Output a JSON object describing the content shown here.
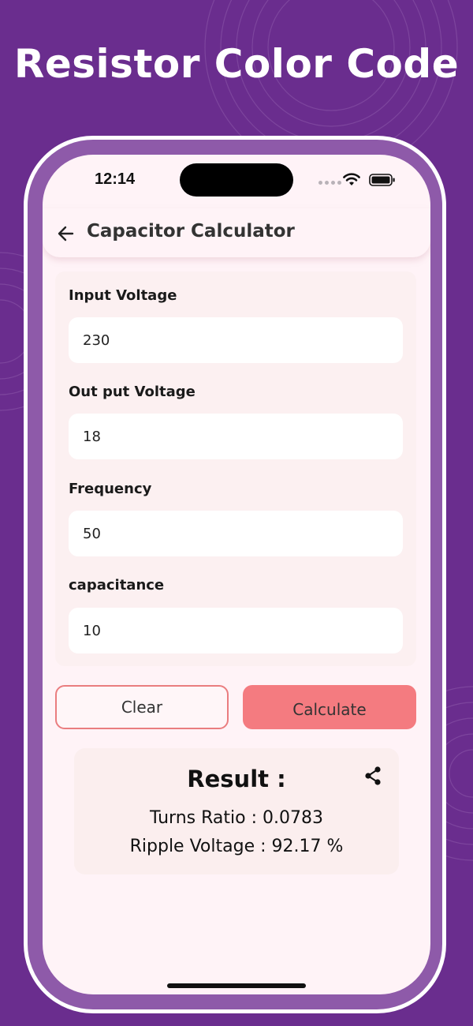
{
  "promo": {
    "title": "Resistor Color Code"
  },
  "status_bar": {
    "time": "12:14"
  },
  "app_bar": {
    "title": "Capacitor Calculator"
  },
  "form": {
    "input_voltage": {
      "label": "Input Voltage",
      "value": "230"
    },
    "output_voltage": {
      "label": "Out put Voltage",
      "value": "18"
    },
    "frequency": {
      "label": "Frequency",
      "value": "50"
    },
    "capacitance": {
      "label": "capacitance",
      "value": "10"
    }
  },
  "buttons": {
    "clear": "Clear",
    "calculate": "Calculate"
  },
  "result": {
    "heading": "Result :",
    "turns_ratio": "Turns Ratio : 0.0783",
    "ripple_voltage": "Ripple Voltage : 92.17 %"
  },
  "icons": {
    "back": "arrow-left-icon",
    "share": "share-icon",
    "wifi": "wifi-icon",
    "battery": "battery-icon"
  },
  "colors": {
    "background": "#6a2d8e",
    "phone_frame": "#8e5aa9",
    "screen": "#fff3f7",
    "card": "#fcf0f1",
    "accent": "#f47b80",
    "clear_border": "#ea7d7f"
  }
}
